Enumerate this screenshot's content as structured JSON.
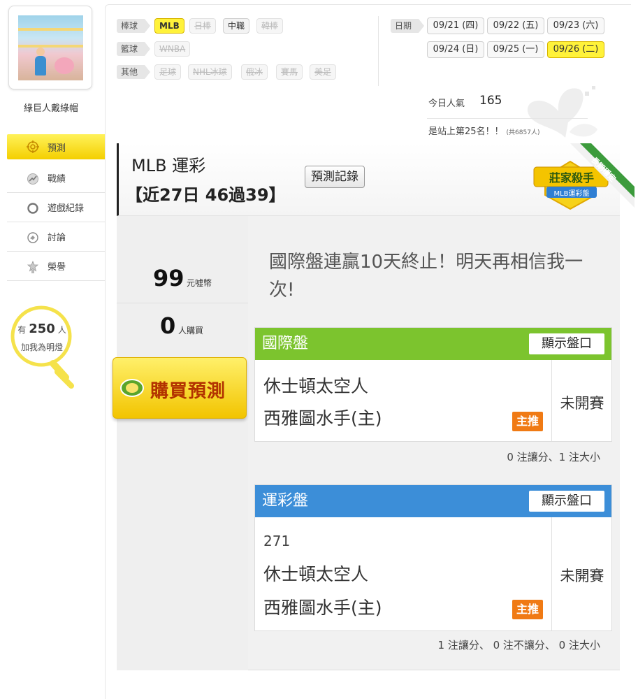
{
  "sidebar": {
    "user_name": "綠巨人戴綠帽",
    "nav": [
      {
        "label": "預測",
        "icon": "target-icon"
      },
      {
        "label": "戰績",
        "icon": "chart-icon"
      },
      {
        "label": "遊戲紀錄",
        "icon": "circle-icon"
      },
      {
        "label": "討論",
        "icon": "chat-icon"
      },
      {
        "label": "榮譽",
        "icon": "medal-icon"
      }
    ],
    "lamp": {
      "prefix": "有",
      "count": "250",
      "suffix": "人",
      "caption": "加我為明燈"
    }
  },
  "filters": {
    "rows": [
      {
        "label": "棒球",
        "items": [
          {
            "text": "MLB",
            "state": "on"
          },
          {
            "text": "日棒",
            "state": "off"
          },
          {
            "text": "中職",
            "state": "normal"
          },
          {
            "text": "韓棒",
            "state": "off"
          }
        ]
      },
      {
        "label": "籃球",
        "items": [
          {
            "text": "WNBA",
            "state": "off"
          }
        ]
      },
      {
        "label": "其他",
        "items": [
          {
            "text": "足球",
            "state": "off"
          },
          {
            "text": "NHL冰球",
            "state": "off"
          },
          {
            "text": "俄冰",
            "state": "off"
          },
          {
            "text": "賽馬",
            "state": "off"
          },
          {
            "text": "美足",
            "state": "off"
          }
        ]
      }
    ],
    "date_label": "日期",
    "dates": [
      {
        "text": "09/21 (四)",
        "active": false
      },
      {
        "text": "09/22 (五)",
        "active": false
      },
      {
        "text": "09/23 (六)",
        "active": false
      },
      {
        "text": "09/24 (日)",
        "active": false
      },
      {
        "text": "09/25 (一)",
        "active": false
      },
      {
        "text": "09/26 (二)",
        "active": true
      }
    ]
  },
  "popularity": {
    "label": "今日人氣",
    "value": "165",
    "rank": "是站上第25名！！",
    "rank_total": "(共6857人)"
  },
  "header": {
    "title": "MLB 運彩",
    "record": "【近27日 46過39】",
    "record_button": "預測記錄",
    "badge_main": "莊家殺手",
    "badge_sub": "MLB運彩盤",
    "ribbon": "長期穩定"
  },
  "purchase": {
    "price": "99",
    "price_unit": "元噓幣",
    "buyers": "0",
    "buyers_unit": "人購買",
    "buy_button": "購買預測"
  },
  "headline": "國際盤連贏10天終止！明天再相信我一次!",
  "markets": [
    {
      "title": "國際盤",
      "show_button": "顯示盤口",
      "game_no": "",
      "away": "休士頓太空人",
      "home": "西雅圖水手(主)",
      "pick": "主推",
      "status": "未開賽",
      "stats": "0 注讓分、1 注大小"
    },
    {
      "title": "運彩盤",
      "show_button": "顯示盤口",
      "game_no": "271",
      "away": "休士頓太空人",
      "home": "西雅圖水手(主)",
      "pick": "主推",
      "status": "未開賽",
      "stats": "1 注讓分、 0 注不讓分、 0 注大小"
    }
  ],
  "colors": {
    "accent_yellow": "#fff23a",
    "intl_green": "#7cc42e",
    "lottery_blue": "#3c8ed8",
    "pick_orange": "#f07a14",
    "buy_text": "#b23200"
  }
}
